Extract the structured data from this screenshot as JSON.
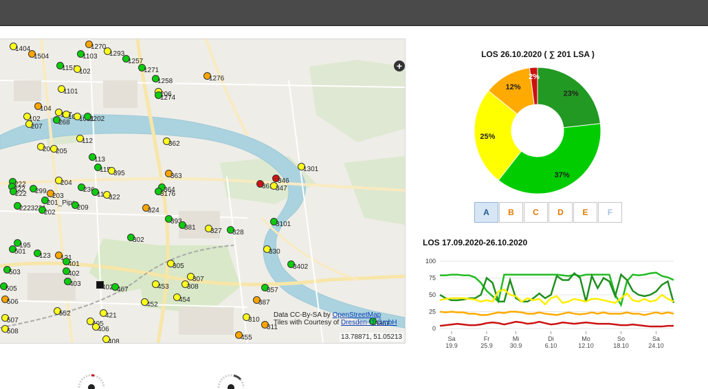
{
  "map": {
    "zoom_button": "+",
    "attribution_line1_prefix": "Data CC-By-SA by ",
    "attribution_line1_link": "OpenStreetMap",
    "attribution_line2_prefix": "Tiles with Courtesy of ",
    "attribution_line2_link": "Dresden-IT GmbH",
    "coordinates": "13.78871, 51.05213",
    "colors": {
      "green": "#0dcc0d",
      "yellow": "#ffff1e",
      "orange": "#ffa500",
      "red": "#cc1414"
    },
    "markers": [
      {
        "label": "1404",
        "c": "y"
      },
      {
        "label": "1504",
        "c": "o"
      },
      {
        "label": "1103",
        "c": "g"
      },
      {
        "label": "1270",
        "c": "o"
      },
      {
        "label": "1293",
        "c": "y"
      },
      {
        "label": "1257",
        "c": "g"
      },
      {
        "label": "1151",
        "c": "g"
      },
      {
        "label": "102",
        "c": "y"
      },
      {
        "label": "1271",
        "c": "g"
      },
      {
        "label": "1276",
        "c": "o"
      },
      {
        "label": "1258",
        "c": "g"
      },
      {
        "label": "1101",
        "c": "y"
      },
      {
        "label": "206",
        "c": "y"
      },
      {
        "label": "1274",
        "c": "g"
      },
      {
        "label": "104",
        "c": "o"
      },
      {
        "label": "107",
        "c": "y"
      },
      {
        "label": "108",
        "c": "y"
      },
      {
        "label": "1051",
        "c": "y"
      },
      {
        "label": "1202",
        "c": "g"
      },
      {
        "label": "102",
        "c": "y"
      },
      {
        "label": "207",
        "c": "y"
      },
      {
        "label": "268",
        "c": "g"
      },
      {
        "label": "112",
        "c": "y"
      },
      {
        "label": "362",
        "c": "y"
      },
      {
        "label": "206",
        "c": "y"
      },
      {
        "label": "205",
        "c": "y"
      },
      {
        "label": "113",
        "c": "g"
      },
      {
        "label": "1301",
        "c": "y"
      },
      {
        "label": "115",
        "c": "g"
      },
      {
        "label": "395",
        "c": "y"
      },
      {
        "label": "363",
        "c": "o"
      },
      {
        "label": "222",
        "c": "g"
      },
      {
        "label": "204",
        "c": "y"
      },
      {
        "label": "346",
        "c": "r"
      },
      {
        "label": "361",
        "c": "r"
      },
      {
        "label": "347",
        "c": "y"
      },
      {
        "label": "222",
        "c": "g"
      },
      {
        "label": "299",
        "c": "g"
      },
      {
        "label": "236",
        "c": "g"
      },
      {
        "label": "364",
        "c": "g"
      },
      {
        "label": "222",
        "c": "g"
      },
      {
        "label": "203",
        "c": "o"
      },
      {
        "label": "118",
        "c": "g"
      },
      {
        "label": "322",
        "c": "y"
      },
      {
        "label": "3176",
        "c": "g"
      },
      {
        "label": "201_Pips",
        "c": "g"
      },
      {
        "label": "209",
        "c": "g"
      },
      {
        "label": "2223231",
        "c": "g"
      },
      {
        "label": "202",
        "c": "g"
      },
      {
        "label": "324",
        "c": "o"
      },
      {
        "label": "393",
        "c": "g"
      },
      {
        "label": "3101",
        "c": "g"
      },
      {
        "label": "381",
        "c": "g"
      },
      {
        "label": "327",
        "c": "y"
      },
      {
        "label": "328",
        "c": "g"
      },
      {
        "label": "302",
        "c": "g"
      },
      {
        "label": "195",
        "c": "g"
      },
      {
        "label": "501",
        "c": "g"
      },
      {
        "label": "123",
        "c": "g"
      },
      {
        "label": "121",
        "c": "o"
      },
      {
        "label": "401",
        "c": "g"
      },
      {
        "label": "330",
        "c": "y"
      },
      {
        "label": "305",
        "c": "y"
      },
      {
        "label": "3402",
        "c": "g"
      },
      {
        "label": "503",
        "c": "g"
      },
      {
        "label": "402",
        "c": "g"
      },
      {
        "label": "307",
        "c": "y"
      },
      {
        "label": "403",
        "c": "g"
      },
      {
        "label": "308",
        "c": "y"
      },
      {
        "label": "505",
        "c": "g"
      },
      {
        "label": "4021",
        "c": "b"
      },
      {
        "label": "467",
        "c": "g"
      },
      {
        "label": "453",
        "c": "y"
      },
      {
        "label": "357",
        "c": "g"
      },
      {
        "label": "454",
        "c": "y"
      },
      {
        "label": "506",
        "c": "o"
      },
      {
        "label": "452",
        "c": "y"
      },
      {
        "label": "387",
        "c": "o"
      },
      {
        "label": "552",
        "c": "y"
      },
      {
        "label": "421",
        "c": "y"
      },
      {
        "label": "310",
        "c": "y"
      },
      {
        "label": "507",
        "c": "y"
      },
      {
        "label": "405",
        "c": "y"
      },
      {
        "label": "406",
        "c": "y"
      },
      {
        "label": "311",
        "c": "o"
      },
      {
        "label": "3367",
        "c": "g"
      },
      {
        "label": "508",
        "c": "y"
      },
      {
        "label": "455",
        "c": "o"
      },
      {
        "label": "408",
        "c": "y"
      }
    ]
  },
  "donut": {
    "title": "LOS 26.10.2020 ( ∑ 201 LSA )",
    "slices": [
      {
        "label": "23%",
        "value": 23,
        "color": "#229922"
      },
      {
        "label": "37%",
        "value": 37,
        "color": "#00cc00"
      },
      {
        "label": "25%",
        "value": 25,
        "color": "#ffff00"
      },
      {
        "label": "12%",
        "value": 12,
        "color": "#ffaa00"
      },
      {
        "label": "2%",
        "value": 2,
        "color": "#cc1111"
      }
    ]
  },
  "los_buttons": [
    {
      "label": "A",
      "color": "#225a8f",
      "active": true
    },
    {
      "label": "B",
      "color": "#e07b00",
      "active": false
    },
    {
      "label": "C",
      "color": "#e07b00",
      "active": false
    },
    {
      "label": "D",
      "color": "#e07b00",
      "active": false
    },
    {
      "label": "E",
      "color": "#e07b00",
      "active": false
    },
    {
      "label": "F",
      "color": "#a8c4e0",
      "active": false
    }
  ],
  "chart_data": {
    "type": "line",
    "title": "LOS 17.09.2020-26.10.2020",
    "ylim": [
      0,
      100
    ],
    "yticks": [
      "0",
      "25",
      "50",
      "75",
      "100"
    ],
    "xticks": [
      {
        "day": "Sa",
        "date": "19.9",
        "x": 2
      },
      {
        "day": "Fr",
        "date": "25.9",
        "x": 8
      },
      {
        "day": "Mi",
        "date": "30.9",
        "x": 13
      },
      {
        "day": "Di",
        "date": "6.10",
        "x": 19
      },
      {
        "day": "Mo",
        "date": "12.10",
        "x": 25
      },
      {
        "day": "So",
        "date": "18.10",
        "x": 31
      },
      {
        "day": "Sa",
        "date": "24.10",
        "x": 37
      }
    ],
    "series": [
      {
        "color": "#22bb22",
        "values": [
          79,
          79,
          80,
          80,
          79,
          79,
          76,
          68,
          56,
          48,
          40,
          80,
          80,
          80,
          80,
          80,
          80,
          80,
          80,
          80,
          80,
          79,
          78,
          80,
          78,
          80,
          80,
          80,
          80,
          80,
          50,
          35,
          70,
          80,
          79,
          80,
          82,
          83,
          78,
          76,
          72
        ]
      },
      {
        "color": "#1f8f1f",
        "values": [
          50,
          45,
          42,
          42,
          43,
          45,
          45,
          50,
          75,
          68,
          40,
          40,
          72,
          45,
          40,
          40,
          45,
          52,
          45,
          50,
          78,
          72,
          72,
          82,
          75,
          40,
          78,
          60,
          75,
          70,
          48,
          80,
          72,
          56,
          50,
          48,
          50,
          55,
          65,
          70,
          38
        ]
      },
      {
        "color": "#ffee00",
        "values": [
          42,
          44,
          45,
          45,
          45,
          44,
          43,
          40,
          42,
          40,
          55,
          58,
          50,
          48,
          40,
          45,
          42,
          44,
          36,
          45,
          48,
          38,
          40,
          44,
          42,
          40,
          44,
          44,
          42,
          40,
          38,
          45,
          52,
          42,
          40,
          44,
          40,
          42,
          50,
          44,
          40
        ]
      },
      {
        "color": "#ffaa00",
        "values": [
          25,
          24,
          25,
          24,
          24,
          22,
          22,
          20,
          20,
          22,
          24,
          23,
          25,
          25,
          24,
          22,
          22,
          24,
          22,
          21,
          20,
          22,
          24,
          22,
          21,
          22,
          24,
          22,
          24,
          22,
          22,
          22,
          24,
          22,
          22,
          20,
          22,
          24,
          22,
          24,
          22
        ]
      },
      {
        "color": "#cc1111",
        "values": [
          4,
          5,
          6,
          7,
          6,
          5,
          5,
          6,
          8,
          9,
          8,
          6,
          8,
          10,
          9,
          7,
          8,
          10,
          8,
          6,
          7,
          9,
          8,
          7,
          8,
          9,
          8,
          7,
          7,
          7,
          6,
          5,
          5,
          6,
          5,
          4,
          3,
          3,
          3,
          4,
          4
        ]
      }
    ]
  }
}
